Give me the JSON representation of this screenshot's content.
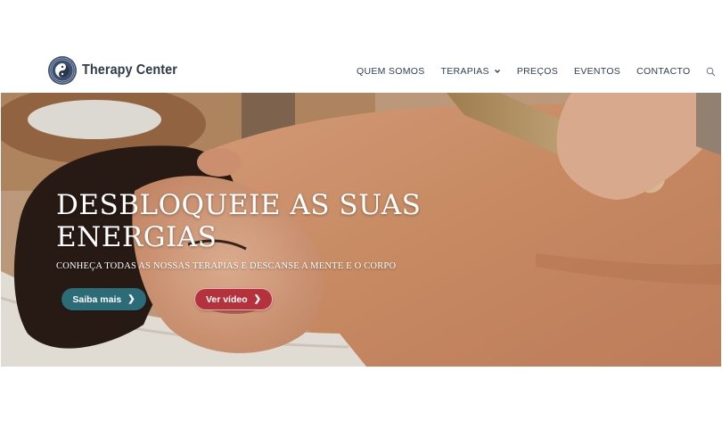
{
  "brand": {
    "name": "Therapy Center",
    "logo_icon": "yin-yang-mandala-icon"
  },
  "nav": {
    "items": [
      {
        "label": "QUEM SOMOS",
        "has_dropdown": false
      },
      {
        "label": "TERAPIAS",
        "has_dropdown": true
      },
      {
        "label": "PREÇOS",
        "has_dropdown": false
      },
      {
        "label": "EVENTOS",
        "has_dropdown": false
      },
      {
        "label": "CONTACTO",
        "has_dropdown": false
      }
    ],
    "search_icon": "search-icon"
  },
  "hero": {
    "title": "DESBLOQUEIE AS SUAS\nENERGIAS",
    "subtitle": "CONHEÇA TODAS AS NOSSAS TERAPIAS E DESCANSE A MENTE E O CORPO",
    "primary_button": {
      "label": "Saiba mais",
      "icon": "chevron-right-icon"
    },
    "secondary_button": {
      "label": "Ver vídeo",
      "icon": "chevron-right-icon"
    }
  },
  "colors": {
    "nav_text": "#2e3f57",
    "primary_button": "#2c6b78",
    "secondary_button": "#b5323c"
  }
}
